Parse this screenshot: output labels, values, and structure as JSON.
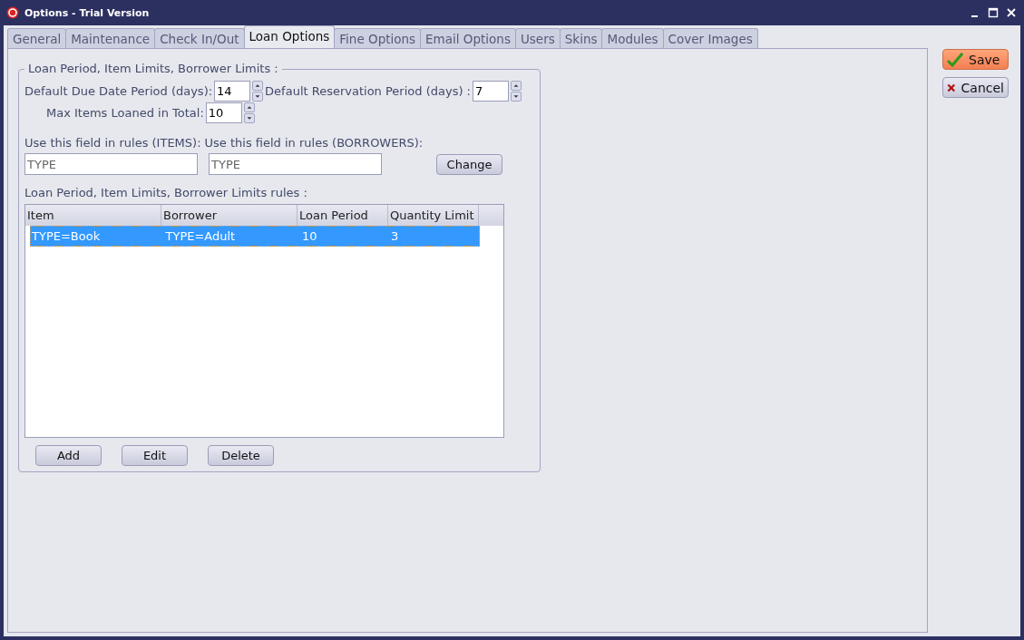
{
  "window": {
    "title": "Options - Trial Version"
  },
  "tabs": [
    {
      "label": "General",
      "selected": false
    },
    {
      "label": "Maintenance",
      "selected": false
    },
    {
      "label": "Check In/Out",
      "selected": false
    },
    {
      "label": "Loan Options",
      "selected": true
    },
    {
      "label": "Fine Options",
      "selected": false
    },
    {
      "label": "Email Options",
      "selected": false
    },
    {
      "label": "Users",
      "selected": false
    },
    {
      "label": "Skins",
      "selected": false
    },
    {
      "label": "Modules",
      "selected": false
    },
    {
      "label": "Cover Images",
      "selected": false
    }
  ],
  "group": {
    "title": "Loan Period, Item Limits, Borrower Limits :",
    "due_date": {
      "label": "Default Due Date Period (days):",
      "value": "14"
    },
    "reservation": {
      "label": "Default Reservation Period (days) :",
      "value": "7"
    },
    "max_items": {
      "label": "Max Items Loaned in Total:",
      "value": "10"
    },
    "items_field": {
      "label": "Use this field in rules (ITEMS):",
      "value": "TYPE"
    },
    "borrowers_field": {
      "label": "Use this field in rules (BORROWERS):",
      "value": "TYPE"
    },
    "change_button": "Change",
    "rules_label": "Loan Period, Item Limits, Borrower Limits rules :",
    "table": {
      "columns": [
        "Item",
        "Borrower",
        "Loan Period",
        "Quantity Limit"
      ],
      "rows": [
        {
          "cells": [
            "TYPE=Book",
            "TYPE=Adult",
            "10",
            "3"
          ],
          "selected": true
        }
      ]
    },
    "buttons": [
      "Add",
      "Edit",
      "Delete"
    ]
  },
  "side_buttons": [
    {
      "label": "Save",
      "kind": "save"
    },
    {
      "label": "Cancel",
      "kind": "cancel"
    }
  ]
}
